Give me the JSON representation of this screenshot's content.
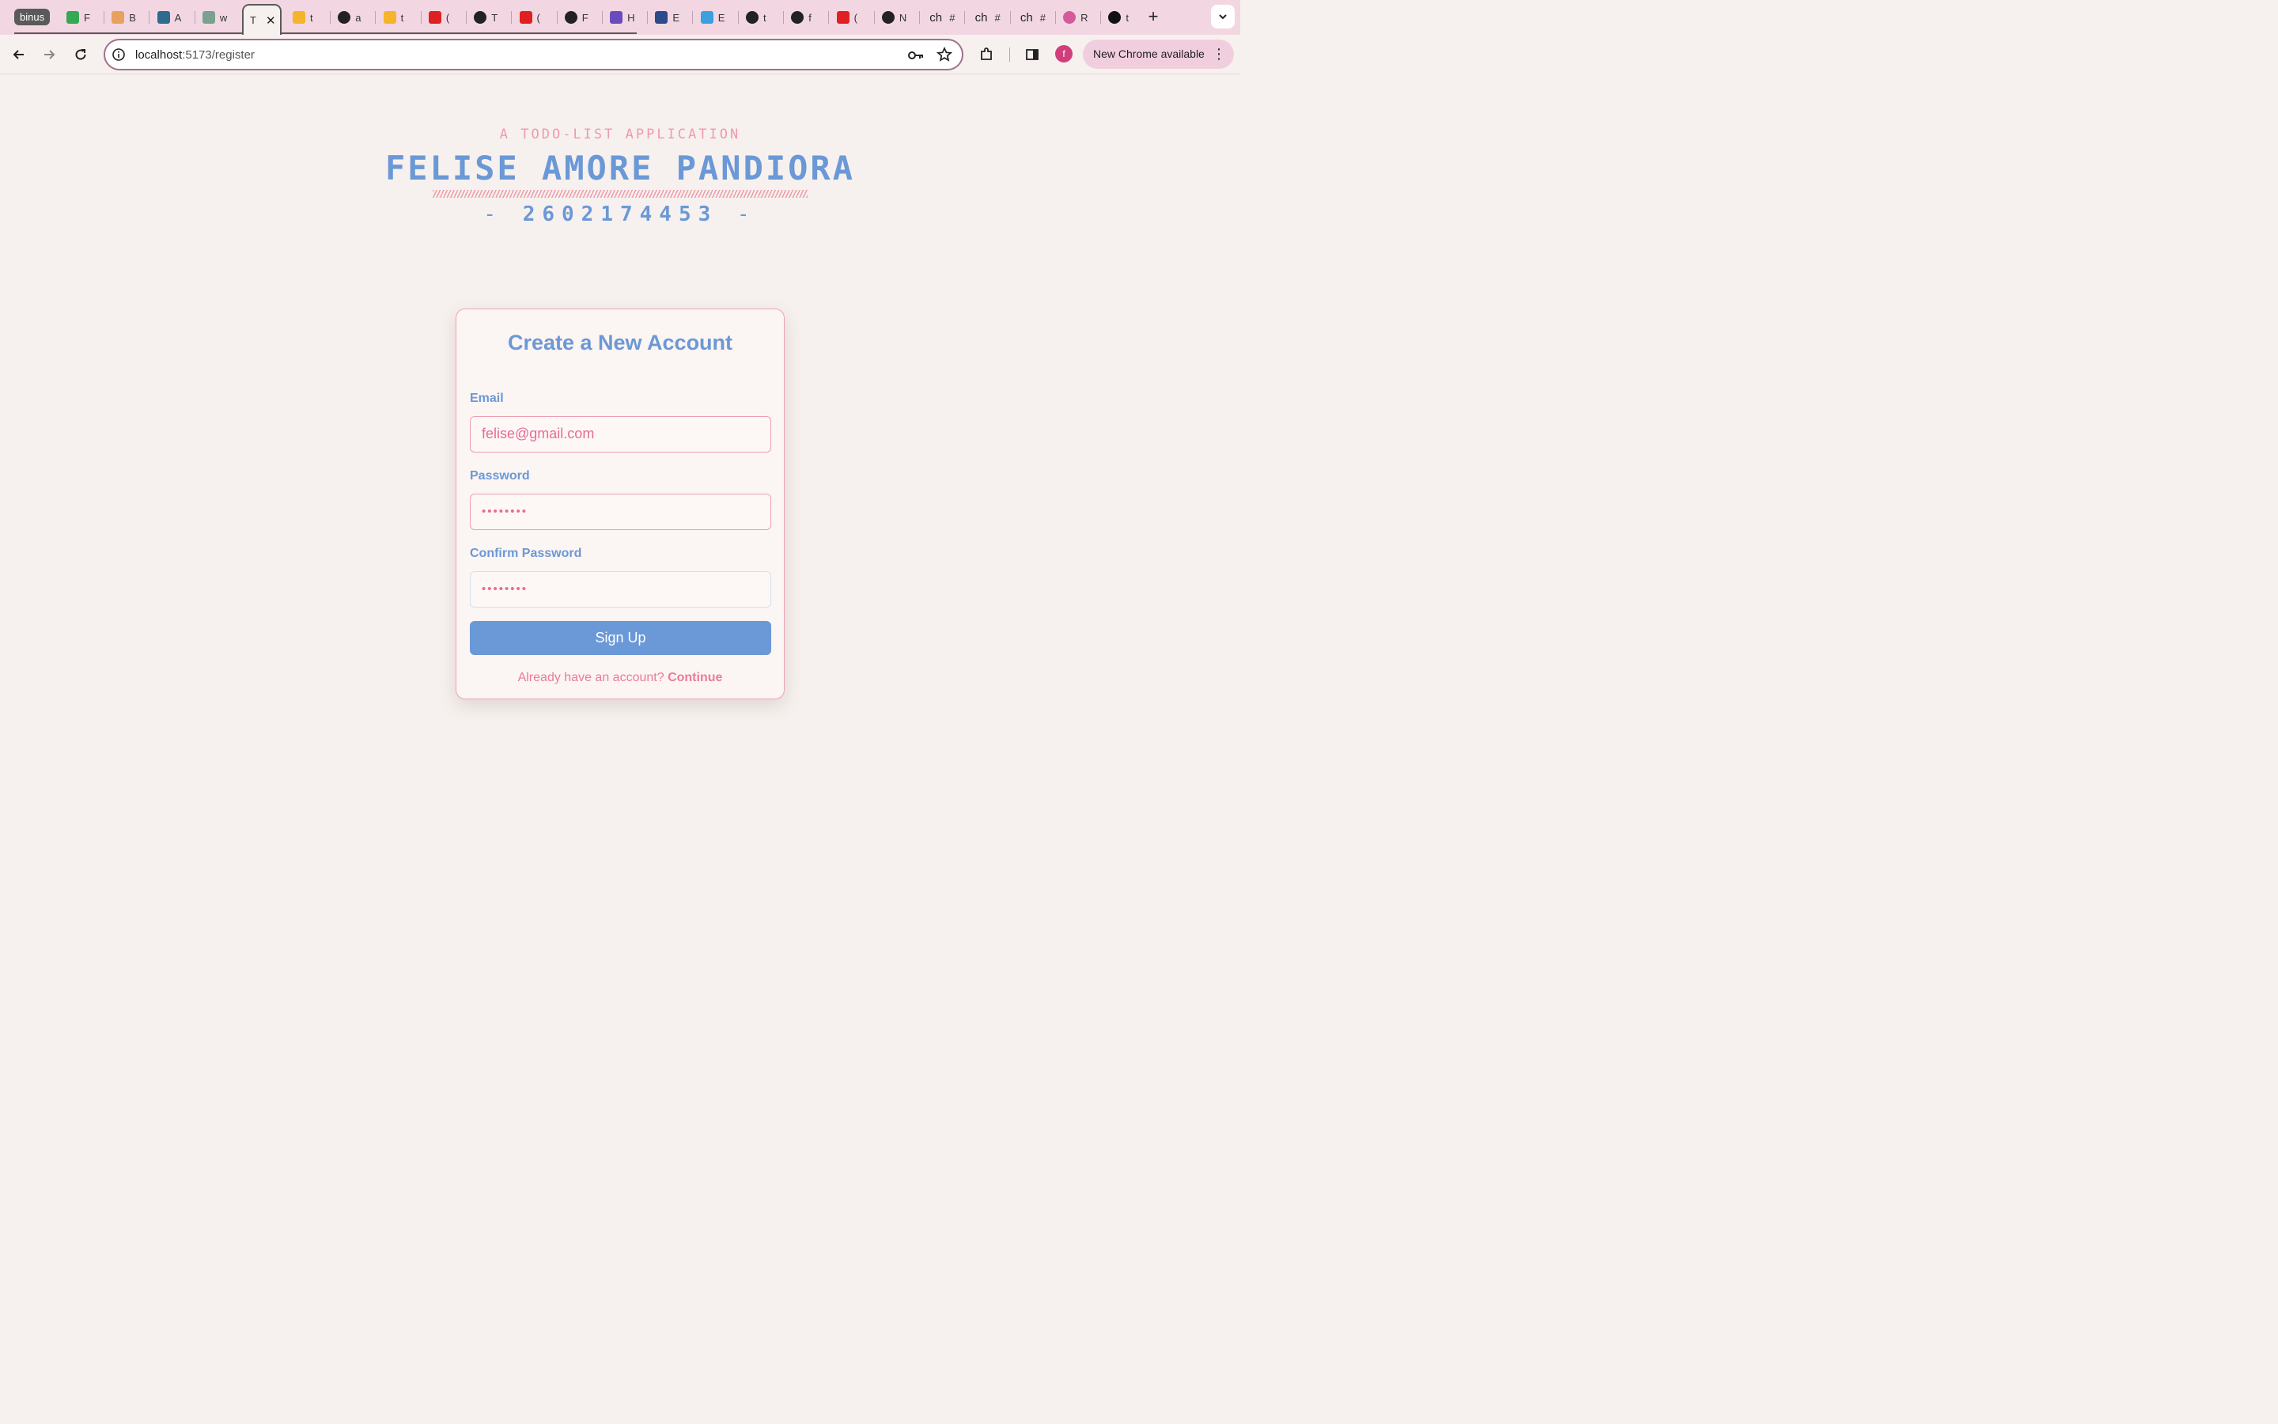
{
  "browser": {
    "tab_group_label": "binus",
    "tabs": [
      {
        "title": "F",
        "icon": "google-drive-icon"
      },
      {
        "title": "B",
        "icon": "binusmaya-icon"
      },
      {
        "title": "A",
        "icon": "forms-icon"
      },
      {
        "title": "w",
        "icon": "chatgpt-icon"
      },
      {
        "title": "T",
        "icon": "page-icon",
        "active": true
      },
      {
        "title": "t",
        "icon": "firebase-icon"
      },
      {
        "title": "a",
        "icon": "github-icon"
      },
      {
        "title": "t",
        "icon": "firebase-icon"
      },
      {
        "title": "(",
        "icon": "youtube-icon"
      },
      {
        "title": "T",
        "icon": "github-icon"
      },
      {
        "title": "(",
        "icon": "youtube-icon"
      },
      {
        "title": "F",
        "icon": "github-icon"
      },
      {
        "title": "H",
        "icon": "app-icon"
      },
      {
        "title": "E",
        "icon": "mdl-icon"
      },
      {
        "title": "E",
        "icon": "play-icon"
      },
      {
        "title": "t",
        "icon": "github-icon"
      },
      {
        "title": "f",
        "icon": "github-icon"
      },
      {
        "title": "(",
        "icon": "youtube-icon"
      },
      {
        "title": "N",
        "icon": "github-icon"
      },
      {
        "title": "#",
        "icon": "ch-icon",
        "icon_text": "ch"
      },
      {
        "title": "#",
        "icon": "ch-icon",
        "icon_text": "ch"
      },
      {
        "title": "#",
        "icon": "ch-icon",
        "icon_text": "ch"
      },
      {
        "title": "R",
        "icon": "react-icon"
      },
      {
        "title": "t",
        "icon": "vercel-icon"
      }
    ],
    "new_tab_label": "+",
    "address": {
      "host": "localhost",
      "path": ":5173/register"
    },
    "profile_initial": "f",
    "update_label": "New Chrome available",
    "menu_glyph": "⋮"
  },
  "hero": {
    "subtitle": "A TODO-LIST APPLICATION",
    "title": "FELISE AMORE PANDIORA",
    "number": "2602174453",
    "dash": "-"
  },
  "form": {
    "title": "Create a New Account",
    "email_label": "Email",
    "email_value": "felise@gmail.com",
    "password_label": "Password",
    "password_value": "••••••••",
    "confirm_label": "Confirm Password",
    "confirm_value": "••••••••",
    "submit_label": "Sign Up",
    "login_prompt": "Already have an account?",
    "login_link": "Continue"
  },
  "colors": {
    "accent_blue": "#6b98d6",
    "accent_pink": "#f09aac",
    "background": "#f6f1ee",
    "tabstrip": "#f2d7e3"
  }
}
